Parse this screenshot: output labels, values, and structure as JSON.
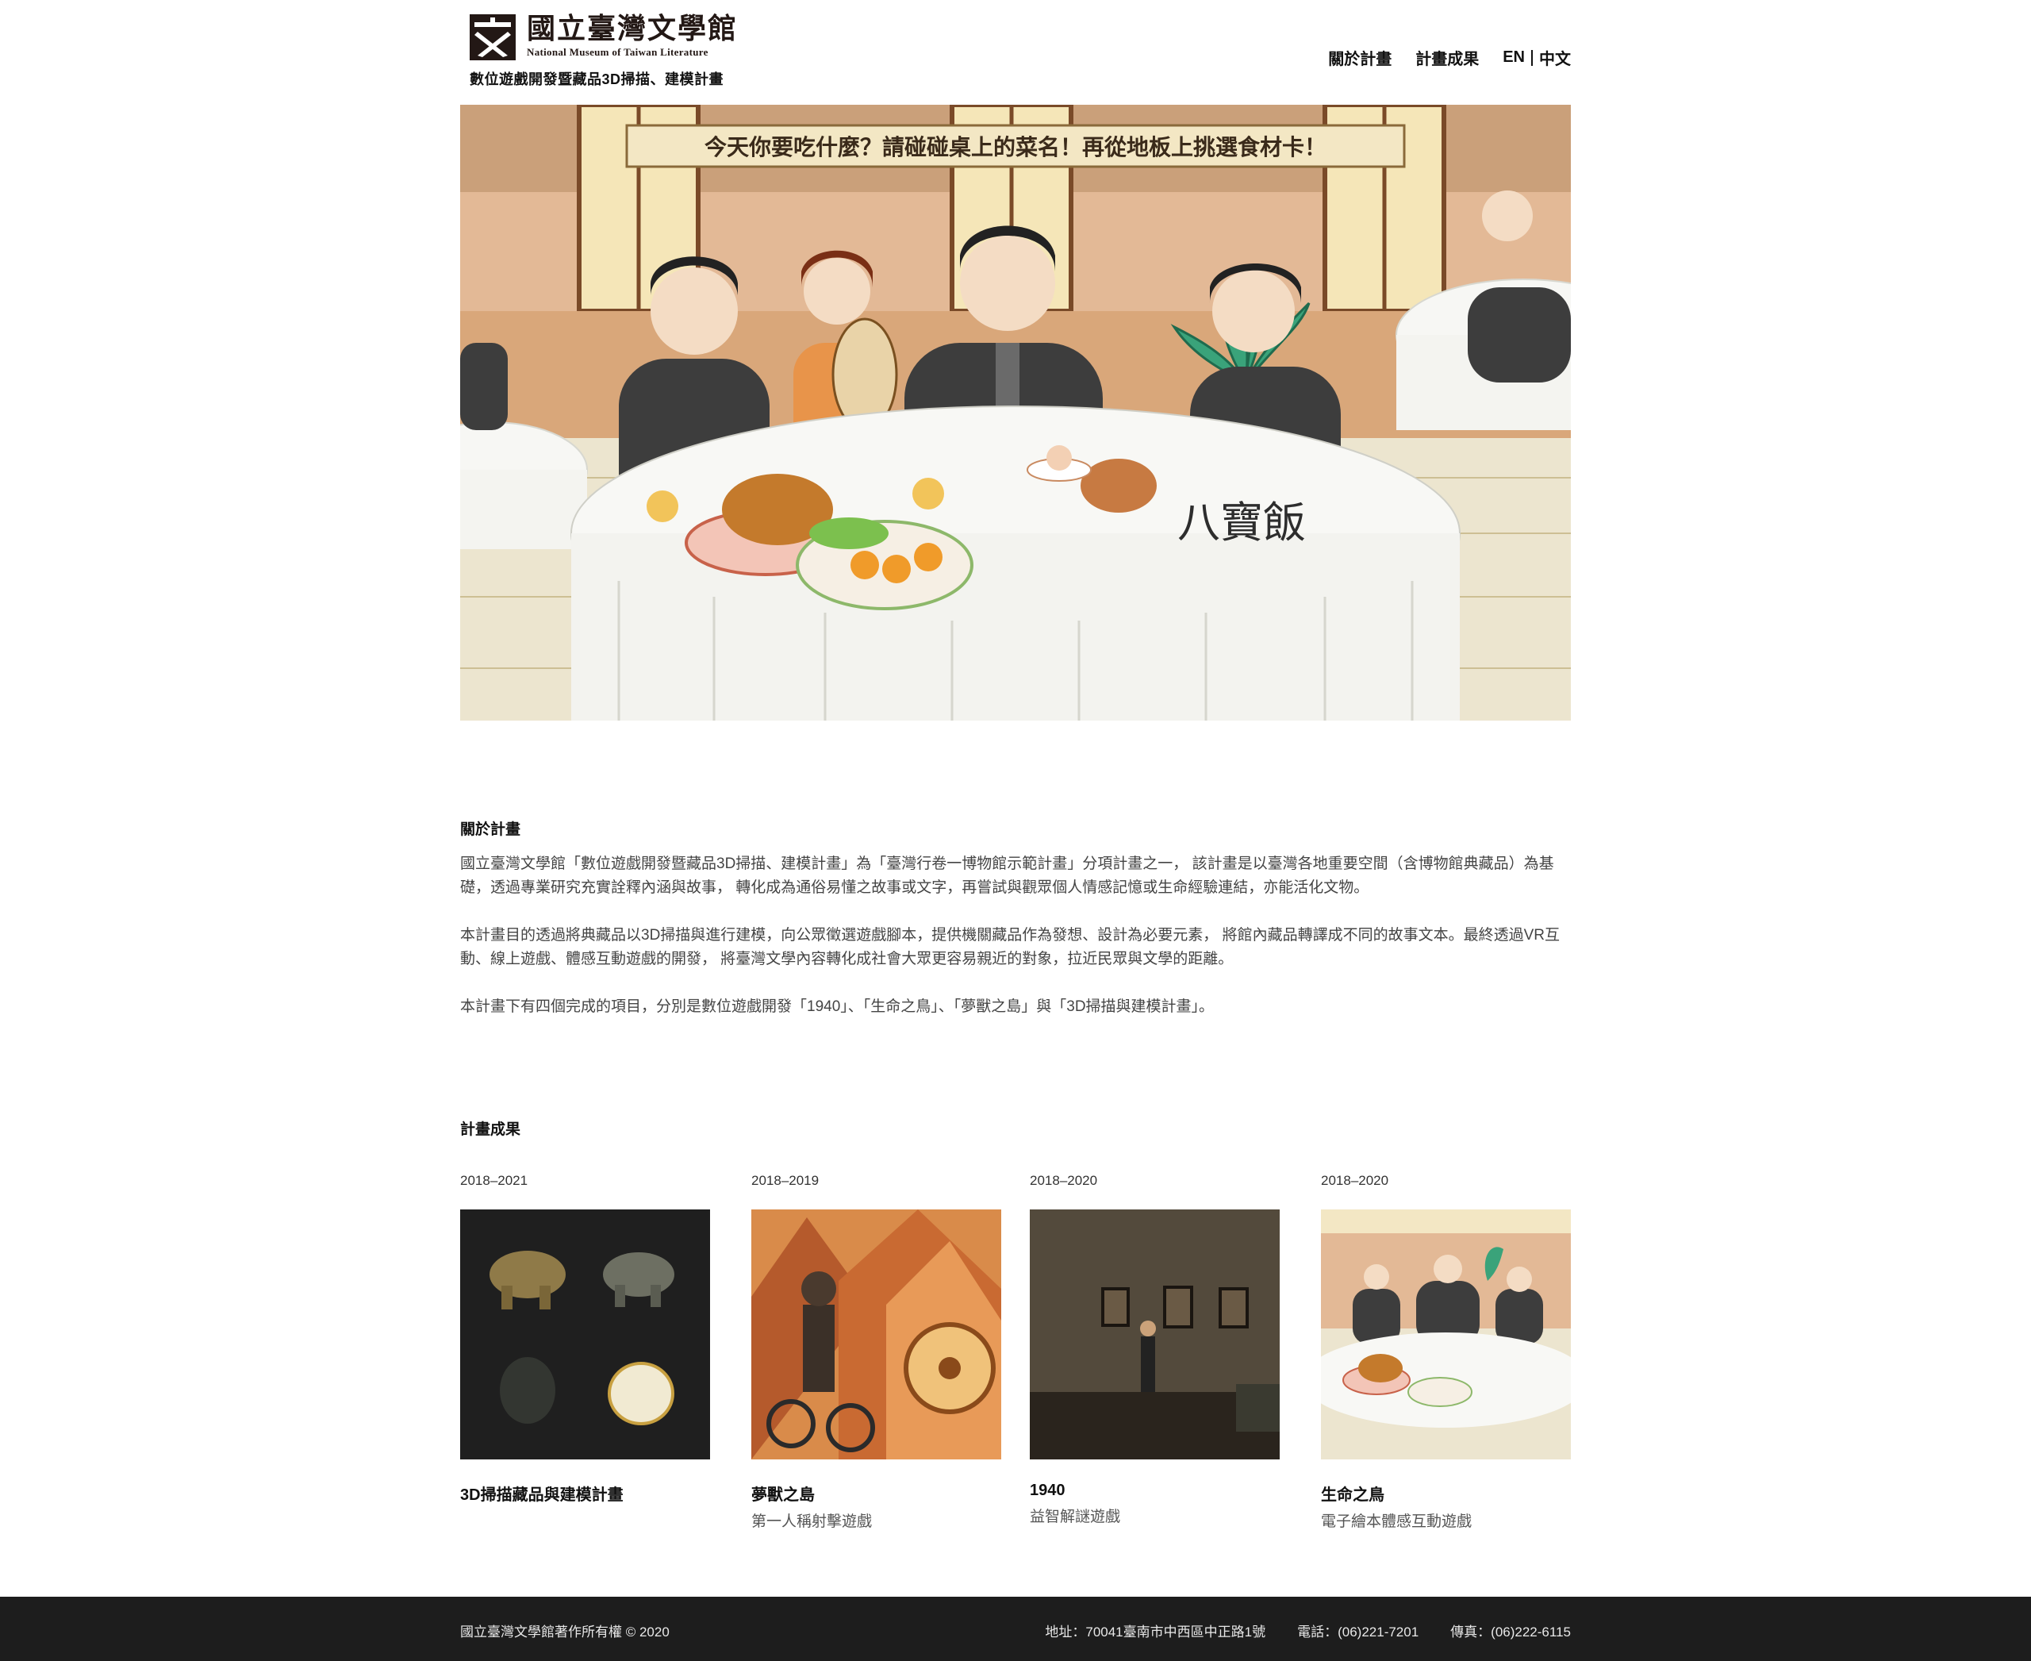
{
  "header": {
    "logo_cn": "國立臺灣文學館",
    "logo_en": "National Museum of Taiwan Literature",
    "subtitle": "數位遊戲開發暨藏品3D掃描、建模計畫",
    "nav": [
      "關於計畫",
      "計畫成果"
    ],
    "lang_en": "EN",
    "lang_zh": "中文"
  },
  "hero": {
    "banner_text": "今天你要吃什麼？請碰碰桌上的菜名！再從地板上挑選食材卡！",
    "dish_label": "八寶飯"
  },
  "about": {
    "title": "關於計畫",
    "paragraphs": [
      "國立臺灣文學館「數位遊戲開發暨藏品3D掃描、建模計畫」為「臺灣行卷一博物館示範計畫」分項計畫之一， 該計畫是以臺灣各地重要空間（含博物館典藏品）為基礎，透過專業研究充實詮釋內涵與故事， 轉化成為通俗易懂之故事或文字，再嘗試與觀眾個人情感記憶或生命經驗連結，亦能活化文物。",
      "本計畫目的透過將典藏品以3D掃描與進行建模，向公眾徵選遊戲腳本，提供機關藏品作為發想、設計為必要元素， 將館內藏品轉譯成不同的故事文本。最終透過VR互動、線上遊戲、體感互動遊戲的開發， 將臺灣文學內容轉化成社會大眾更容易親近的對象，拉近民眾與文學的距離。",
      "本計畫下有四個完成的項目，分別是數位遊戲開發「1940」、「生命之鳥」、「夢獸之島」與「3D掃描與建模計畫」。"
    ]
  },
  "results": {
    "title": "計畫成果",
    "cards": [
      {
        "year": "2018–2021",
        "title": "3D掃描藏品與建模計畫",
        "subtitle": ""
      },
      {
        "year": "2018–2019",
        "title": "夢獸之島",
        "subtitle": "第一人稱射擊遊戲"
      },
      {
        "year": "2018–2020",
        "title": "1940",
        "subtitle": "益智解謎遊戲"
      },
      {
        "year": "2018–2020",
        "title": "生命之鳥",
        "subtitle": "電子繪本體感互動遊戲"
      }
    ]
  },
  "footer": {
    "copyright": "國立臺灣文學館著作所有權 © 2020",
    "address": "地址：70041臺南市中西區中正路1號",
    "phone": "電話：(06)221-7201",
    "fax": "傳真：(06)222-6115"
  }
}
